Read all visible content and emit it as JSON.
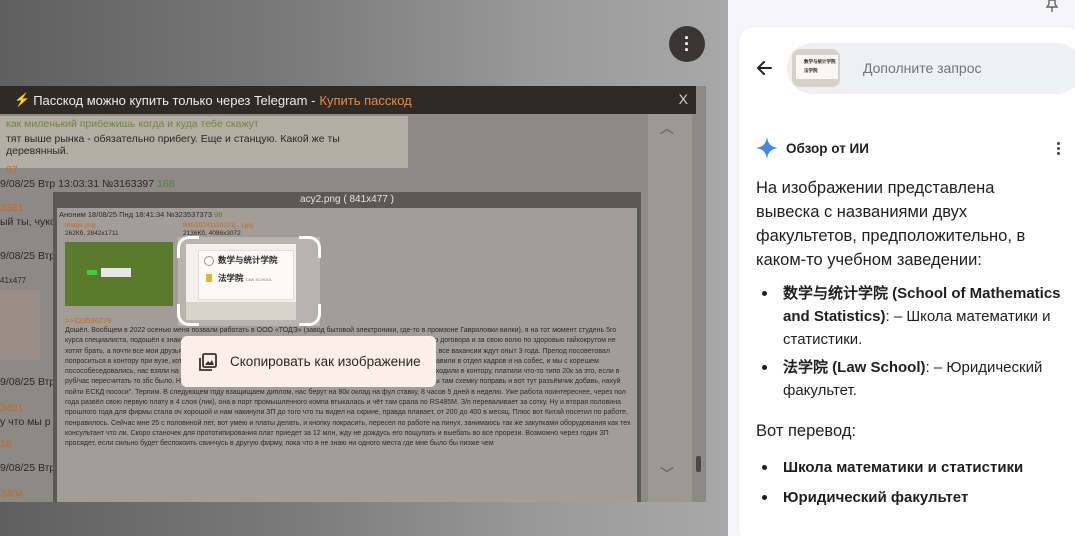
{
  "lens": {
    "telegram_banner": {
      "bolt": "⚡",
      "text": "Пасскод можно купить только через Telegram -",
      "link": "Купить пасскод",
      "close": "X"
    },
    "forum_bg": {
      "post1_line1": "как миленький прибежишь когда и куда тебе скажут",
      "post1_line2": "тят выше рынка - обязательно прибегу. Еще и станцую. Какой же ты деревянный.",
      "post1_ref": "97",
      "meta1": "9/08/25 Втр 13:03:31 №3163397",
      "meta1_count": "168",
      "s1_num": "3381",
      "s1_text": "ый ты, чуко",
      "meta2": "9/08/25 Втр",
      "s2_text": "41x477",
      "meta3": "9/08/25 Втр",
      "s3_num": "3401",
      "s3_text": "у что мы р",
      "s3_ref": "18",
      "meta4": "9/08/25 Втр",
      "s4_num": "3404"
    },
    "viewer": {
      "title": "acy2.png ( 841x477 )",
      "post_header": "Аноним 18/08/25 Пнд 18:41:34 №323537373",
      "post_count": "98",
      "file1_name": "image.png",
      "file1_info": "262Кб, 2842x1711",
      "file2_name": "IMG20241110101[...].jpg",
      "file2_info": "2136Кб, 4096x3072",
      "reply_link": ">>323536279",
      "body": "Дошёл. Вообщем в 2022 осенью меня позвали работать в ООО «ТОДЭ» (завод бытовой электроники, где-то в промзоне Гавриловки вилки), я на тот момент студень 5го курса специалиста, подошёл к знакомому, и мне там открыли доступ через бюро, сорока тысяч без официального договора и за свою волю по здоровью гайкокрутом не хотят брать, а почти все мои друзья летом тоже заканчивали, и ходят без работы, ищут хоть куда нибудь пойти, а все вакансии ждут опыт 3 года. Препод посоветовал попроситься в контору при вузе, которая занимается разработкой для заказчиков, я пошёл, поговорил, меня отправили в отдел кадров и на собес, и мы с корешем посособеседовались, нас взяли на кропальствки по ГПХ. 3 раса вторник после пар, 3 часа четверг после пар мы ходили в контору, платили что-то типо 20к за это, если в руб/час пересчитать то збс было. На нас скидывали всякое говно старое типа \"Вот есть платка в PCAD2006, ну ты там схемку поправь и вот тут разъёмчик добавь, нахуй пойти ЕСКД пососи\". Терпим. В следующем году взащищаем диплом, нас берут на 80к оклад на фул ставку, 8 часов 5 дней в неделю. Уже работа поинтереснее, через пол года развёл свою первую плату в 4 слоя (лик), она в порт промышленного компа втыкалась и чёт там срала по RS485M. З/п переваливает за сотку. Ну и вторая половина прошлого года для фирмы стала оч хорошой и нам накинули ЗП до того что ты видел на скрине, правда плавает, от 200 до 400 в месяц. Плюс вот Китай посетил по работе, понравилось. Сейчас мне 25 с половиной лет, вот умею и платы делать, и кнопку покрасить, пересел по работе на линух, занимаюсь так же закупками оборудования как тех консультант что ли. Скоро станочек для прототипирования плат приедет за 12 млн, жду не дождусь его пощупать и выебать во все прорези. Возможно через годик ЗП просядет, если сильно будет беспокоить свинчусь в другую фирму, пока что я не знаю ни одного места где мне было бы пизже чем"
    },
    "selection_photo": {
      "line1": "数学与统计学院",
      "line2": "法学院",
      "line2_small": "LAW SCHOOL"
    },
    "copy_button": {
      "label": "Скопировать как изображение",
      "icon": "copy-image-icon"
    },
    "menu_icon": "more-vert-icon"
  },
  "panel": {
    "search": {
      "placeholder": "Дополните запрос",
      "thumb_line1": "数学与统计学院",
      "thumb_line2": "法学院"
    },
    "ai_overview": {
      "title": "Обзор от ИИ",
      "summary": "На изображении представлена вывеска с названиями двух факультетов, предположительно, в каком-то учебном заведении:",
      "items": [
        {
          "name": "数学与统计学院 (School of Mathematics and Statistics)",
          "desc": ": – Школа математики и статистики."
        },
        {
          "name": "法学院 (Law School)",
          "desc": ": – Юридический факультет."
        }
      ],
      "translation_heading": "Вот перевод:",
      "translations": [
        "Школа математики и статистики",
        "Юридический факультет"
      ]
    },
    "colors": {
      "accent_blue": "#4285f4",
      "copy_button_bg": "#fcefe9",
      "banner_link": "#ee8a39"
    }
  }
}
